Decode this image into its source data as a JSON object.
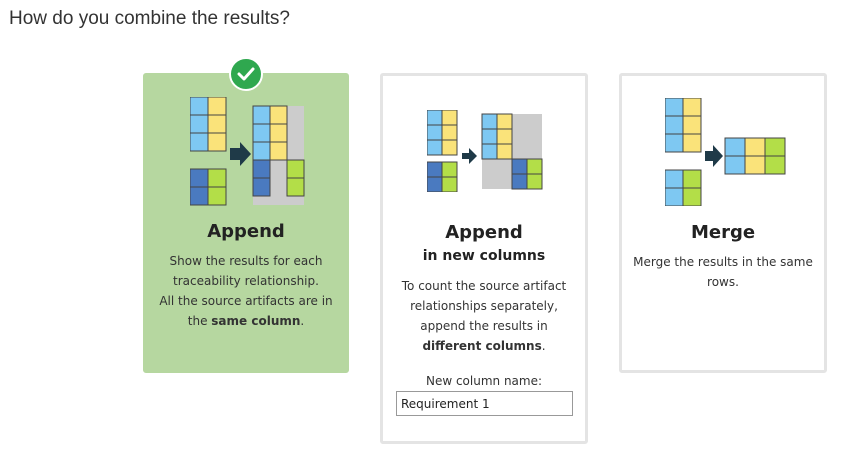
{
  "page_title": "How do you combine the results?",
  "options": {
    "append": {
      "title": "Append",
      "desc_line1": "Show the results for each traceability relationship.",
      "desc_line2_prefix": "All the source artifacts are in the ",
      "desc_line2_bold": "same column",
      "desc_line2_suffix": ".",
      "selected": true
    },
    "new_columns": {
      "title": "Append",
      "subtitle": "in new columns",
      "desc_prefix": "To count the source artifact relationships separately, append the results in ",
      "desc_bold": "different columns",
      "desc_suffix": ".",
      "column_label": "New column name:",
      "column_value": "Requirement 1"
    },
    "merge": {
      "title": "Merge",
      "desc": "Merge the results in the same rows."
    }
  },
  "colors": {
    "selected_card": "#b6d7a0",
    "check_badge": "#2fa84f",
    "cell_blue": "#7ec8f2",
    "cell_yellow": "#fae37a",
    "cell_darkblue": "#4a7ac0",
    "cell_green": "#b3de48",
    "cell_gray": "#cccccc",
    "arrow": "#1f3a48"
  }
}
